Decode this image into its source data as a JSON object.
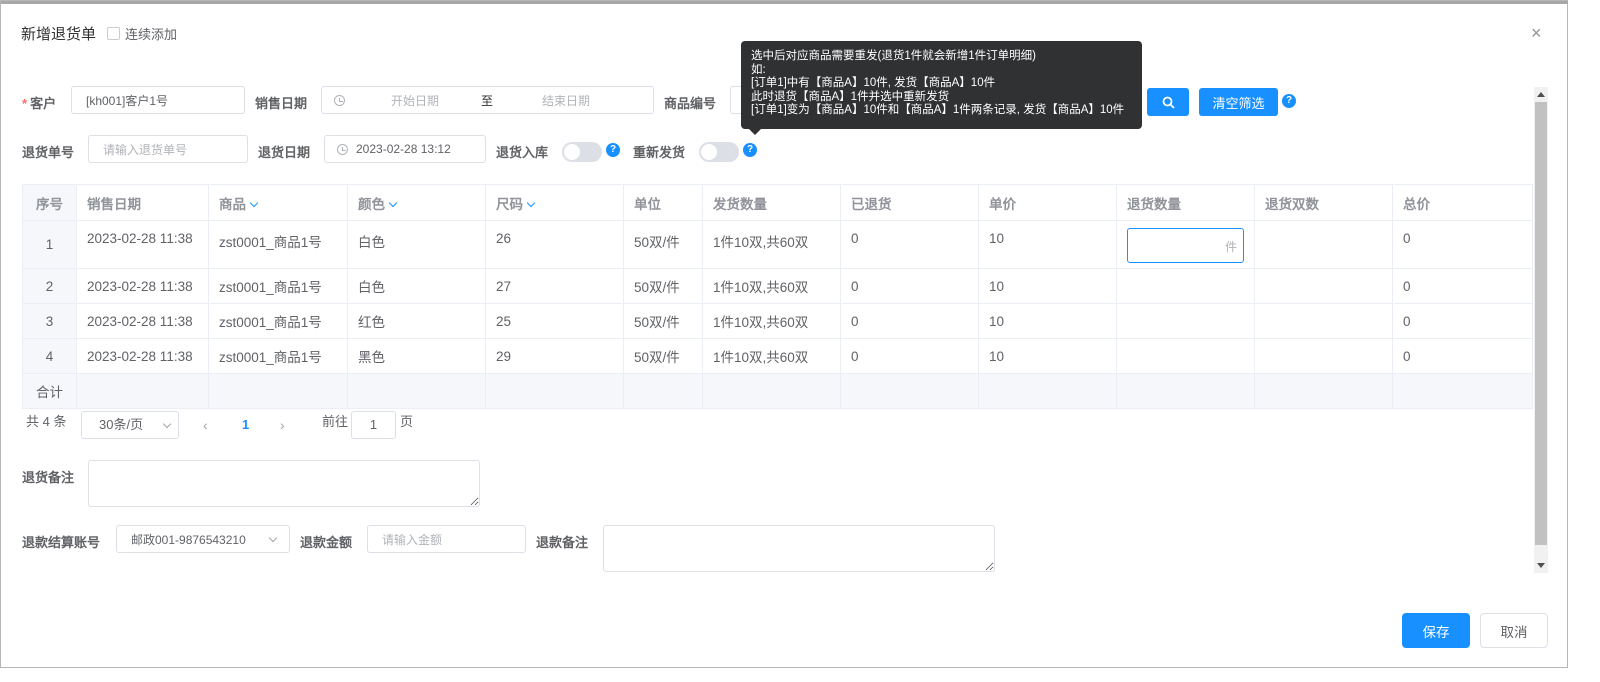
{
  "dialog": {
    "title": "新增退货单",
    "continuous_add_label": "连续添加",
    "close_symbol": "×"
  },
  "filters": {
    "customer_label": "客户",
    "customer_required_mark": "*",
    "customer_value": "[kh001]客户1号",
    "sale_date_label": "销售日期",
    "start_date_placeholder": "开始日期",
    "date_separator": "至",
    "end_date_placeholder": "结束日期",
    "product_code_label": "商品编号",
    "clear_filter_label": "清空筛选",
    "return_no_label": "退货单号",
    "return_no_placeholder": "请输入退货单号",
    "return_date_label": "退货日期",
    "return_date_value": "2023-02-28 13:12",
    "return_stock_label": "退货入库",
    "reship_label": "重新发货",
    "help_symbol": "?"
  },
  "tooltip": {
    "lines": [
      "选中后对应商品需要重发(退货1件就会新增1件订单明细)",
      "如:",
      "[订单1]中有【商品A】10件, 发货【商品A】10件",
      "此时退货【商品A】1件并选中重新发货",
      "[订单1]变为【商品A】10件和【商品A】1件两条记录, 发货【商品A】10件"
    ]
  },
  "table": {
    "headers": {
      "index": "序号",
      "sale_date": "销售日期",
      "product": "商品",
      "color": "颜色",
      "size": "尺码",
      "unit": "单位",
      "ship_qty": "发货数量",
      "returned": "已退货",
      "price": "单价",
      "return_qty": "退货数量",
      "return_pairs": "退货双数",
      "total": "总价"
    },
    "qty_unit_suffix": "件",
    "rows": [
      {
        "index": "1",
        "sale_date": "2023-02-28 11:38",
        "product": "zst0001_商品1号",
        "color": "白色",
        "size": "26",
        "unit": "50双/件",
        "ship_qty": "1件10双,共60双",
        "returned": "0",
        "price": "10",
        "return_qty": "",
        "return_pairs": "",
        "total": "0"
      },
      {
        "index": "2",
        "sale_date": "2023-02-28 11:38",
        "product": "zst0001_商品1号",
        "color": "白色",
        "size": "27",
        "unit": "50双/件",
        "ship_qty": "1件10双,共60双",
        "returned": "0",
        "price": "10",
        "return_qty": "",
        "return_pairs": "",
        "total": "0"
      },
      {
        "index": "3",
        "sale_date": "2023-02-28 11:38",
        "product": "zst0001_商品1号",
        "color": "红色",
        "size": "25",
        "unit": "50双/件",
        "ship_qty": "1件10双,共60双",
        "returned": "0",
        "price": "10",
        "return_qty": "",
        "return_pairs": "",
        "total": "0"
      },
      {
        "index": "4",
        "sale_date": "2023-02-28 11:38",
        "product": "zst0001_商品1号",
        "color": "黑色",
        "size": "29",
        "unit": "50双/件",
        "ship_qty": "1件10双,共60双",
        "returned": "0",
        "price": "10",
        "return_qty": "",
        "return_pairs": "",
        "total": "0"
      }
    ],
    "sum_label": "合计"
  },
  "pagination": {
    "total_text": "共 4 条",
    "page_size": "30条/页",
    "prev": "‹",
    "current_page": "1",
    "next": "›",
    "goto_label": "前往",
    "goto_value": "1",
    "page_suffix": "页"
  },
  "bottom": {
    "return_remark_label": "退货备注",
    "refund_account_label": "退款结算账号",
    "refund_account_value": "邮政001-9876543210",
    "refund_amount_label": "退款金额",
    "refund_amount_placeholder": "请输入金额",
    "refund_remark_label": "退款备注"
  },
  "actions": {
    "save": "保存",
    "cancel": "取消"
  },
  "colors": {
    "primary": "#1890ff",
    "required": "#f56c6c",
    "tooltip_bg": "#303133"
  }
}
